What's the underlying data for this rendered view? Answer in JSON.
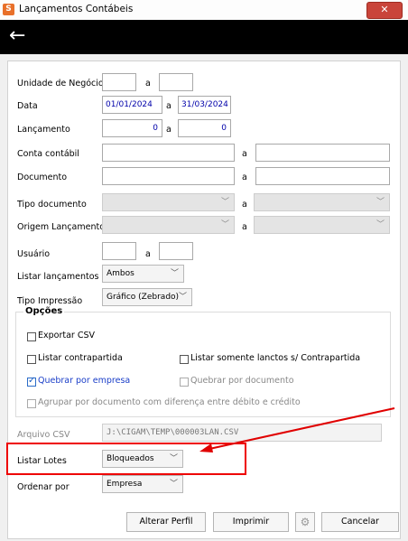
{
  "window": {
    "title": "Lançamentos Contábeis",
    "app_icon": "S",
    "close_label": "✕"
  },
  "header": {
    "back_icon": "←"
  },
  "form": {
    "unidade": {
      "label": "Unidade de Negócio",
      "sep": "a",
      "from": "",
      "to": ""
    },
    "data": {
      "label": "Data",
      "sep": "a",
      "from": "01/01/2024",
      "to": "31/03/2024"
    },
    "lancamento": {
      "label": "Lançamento",
      "sep": "a",
      "from": "0",
      "to": "0"
    },
    "conta": {
      "label": "Conta contábil",
      "sep": "a",
      "from": "",
      "to": ""
    },
    "documento": {
      "label": "Documento",
      "sep": "a",
      "from": "",
      "to": ""
    },
    "tipo_documento": {
      "label": "Tipo documento",
      "sep": "a",
      "from": "",
      "to": ""
    },
    "origem": {
      "label": "Origem Lançamento",
      "sep": "a",
      "from": "",
      "to": ""
    },
    "usuario": {
      "label": "Usuário",
      "sep": "a",
      "from": "",
      "to": ""
    },
    "listar_lancamentos": {
      "label": "Listar lançamentos",
      "value": "Ambos"
    },
    "tipo_impressao": {
      "label": "Tipo Impressão",
      "value": "Gráfico (Zebrado)"
    }
  },
  "opcoes": {
    "title": "Opções",
    "exportar_csv": {
      "label": "Exportar CSV",
      "checked": false
    },
    "listar_contrapartida": {
      "label": "Listar contrapartida",
      "checked": false
    },
    "listar_somente": {
      "label": "Listar somente lanctos s/ Contrapartida",
      "checked": false
    },
    "quebrar_empresa": {
      "label": "Quebrar por empresa",
      "checked": true
    },
    "quebrar_documento": {
      "label": "Quebrar por documento",
      "checked": false
    },
    "agrupar": {
      "label": "Agrupar por documento com diferença entre débito e crédito",
      "checked": false
    }
  },
  "arquivo_csv": {
    "label": "Arquivo CSV",
    "value": "J:\\CIGAM\\TEMP\\000003LAN.CSV"
  },
  "listar_lotes": {
    "label": "Listar Lotes",
    "value": "Bloqueados"
  },
  "ordenar_por": {
    "label": "Ordenar por",
    "value": "Empresa"
  },
  "buttons": {
    "alterar_perfil": "Alterar Perfil",
    "imprimir": "Imprimir",
    "settings_icon": "gear-icon",
    "cancelar": "Cancelar"
  },
  "colors": {
    "annotation": "#e00000",
    "header": "#000000",
    "value_blue": "#0000aa"
  }
}
